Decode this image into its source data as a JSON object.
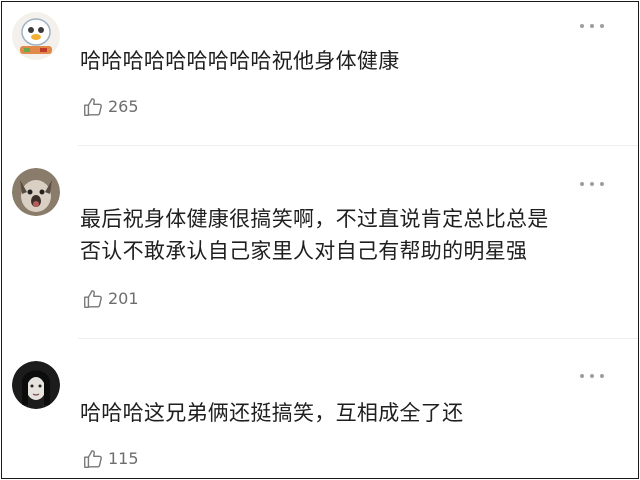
{
  "comments": [
    {
      "avatar": "cartoon-avatar",
      "lines": [
        "哈哈哈哈哈哈哈哈哈祝他身体健康"
      ],
      "likes": "265"
    },
    {
      "avatar": "dog-avatar",
      "lines": [
        "最后祝身体健康很搞笑啊，不过直说肯定总比总是",
        "否认不敢承认自己家里人对自己有帮助的明星强"
      ],
      "likes": "201"
    },
    {
      "avatar": "portrait-avatar",
      "lines": [
        "哈哈哈这兄弟俩还挺搞笑，互相成全了还"
      ],
      "likes": "115"
    }
  ],
  "colors": {
    "text": "#1f1f1f",
    "meta": "#6d6d6d",
    "divider": "#eeeeee"
  }
}
